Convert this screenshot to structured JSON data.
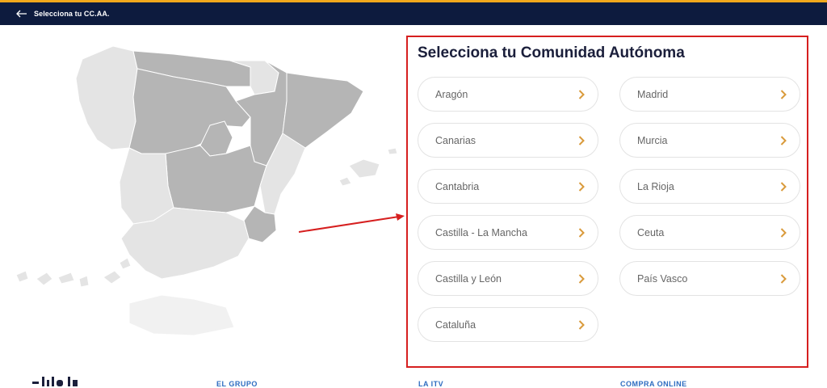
{
  "header": {
    "back_icon": "arrow-left-icon",
    "title": "Selecciona tu CC.AA."
  },
  "panel": {
    "heading": "Selecciona tu Comunidad Autónoma",
    "chevron_icon": "chevron-right-icon",
    "chevron_color": "#d99a3b",
    "left_column": [
      {
        "label": "Aragón"
      },
      {
        "label": "Canarias"
      },
      {
        "label": "Cantabria"
      },
      {
        "label": "Castilla - La Mancha"
      },
      {
        "label": "Castilla y León"
      },
      {
        "label": "Cataluña"
      }
    ],
    "right_column": [
      {
        "label": "Madrid"
      },
      {
        "label": "Murcia"
      },
      {
        "label": "La Rioja"
      },
      {
        "label": "Ceuta"
      },
      {
        "label": "País Vasco"
      }
    ]
  },
  "annotation": {
    "highlight_color": "#d61f1f"
  },
  "colors": {
    "topbar": "#0d1b3e",
    "topbar_accent": "#f0a81c",
    "map_active": "#b5b5b5",
    "map_inactive": "#e4e4e4"
  },
  "footer": {
    "links": [
      "EL GRUPO",
      "LA ITV",
      "COMPRA ONLINE"
    ]
  }
}
